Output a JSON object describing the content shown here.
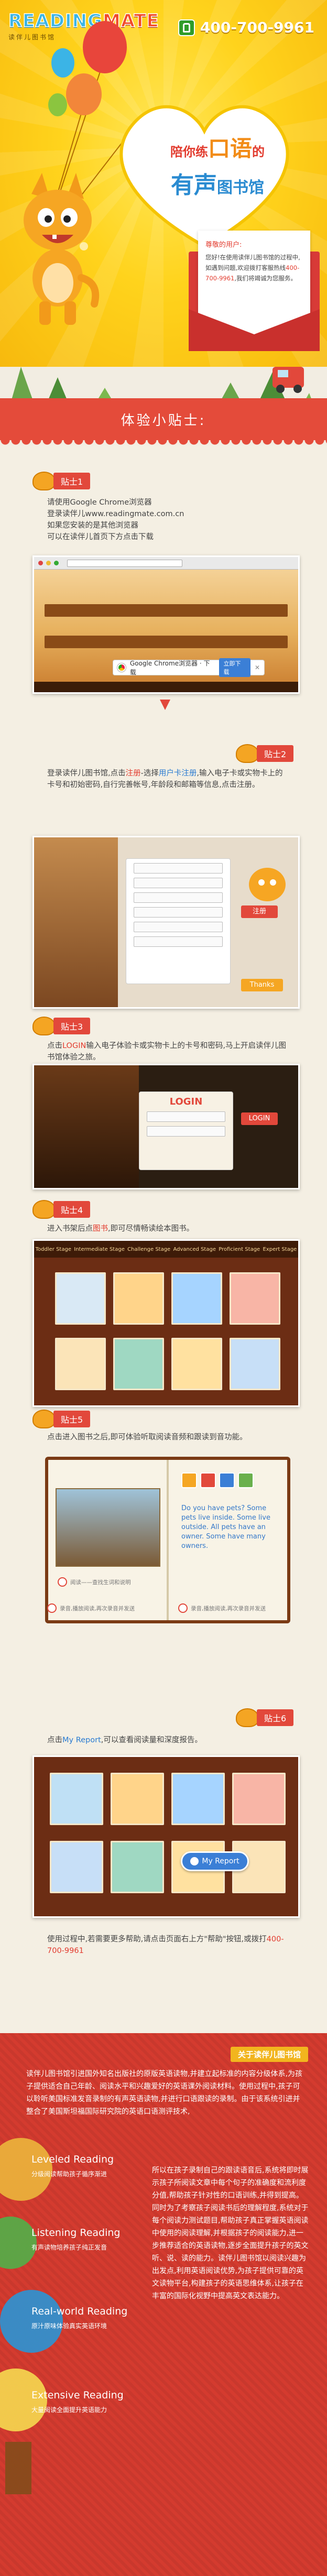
{
  "header": {
    "logo_text_1": "READING",
    "logo_text_2": "MATE",
    "logo_subtitle": "读伴儿图书馆",
    "hotline": "400-700-9961"
  },
  "hero": {
    "line1_pre": "陪你练",
    "line1_big": "口语",
    "line1_post": "的",
    "line2_big": "有声",
    "line2_post": "图书馆"
  },
  "envelope": {
    "greeting": "尊敬的用户:",
    "body_pre": "您好!在使用读伴儿图书馆的过程中,如遇到问题,欢迎拨打客服热线",
    "body_phone": "400-700-9961",
    "body_post": ",我们将竭诚为您服务。"
  },
  "banner": {
    "title": "体验小贴士:"
  },
  "steps": [
    {
      "label": "贴士1",
      "lines": [
        "请使用Google Chrome浏览器",
        "登录读伴儿www.readingmate.com.cn",
        "如果您安装的是其他浏览器",
        "可以在读伴儿首页下方点击下载"
      ],
      "chrome_bar_text": "Google Chrome浏览器 · 下载",
      "chrome_bar_btn": "立即下载"
    },
    {
      "label": "贴士2",
      "text_pre": "登录读伴儿图书馆,点击",
      "text_red": "注册",
      "text_mid": "-选择",
      "text_blue": "用户卡注册",
      "text_post": ",输入电子卡或实物卡上的卡号和初始密码,自行完善帐号,年龄段和邮箱等信息,点击注册。",
      "button_register": "注册",
      "button_thanks": "Thanks"
    },
    {
      "label": "贴士3",
      "text_pre": "点击",
      "text_red": "LOGIN",
      "text_post": "输入电子体验卡或实物卡上的卡号和密码,马上开启读伴儿图书馆体验之旅。",
      "login_title": "LOGIN",
      "login_btn": "LOGIN"
    },
    {
      "label": "贴士4",
      "text_pre": "进入书架后点",
      "text_red": "图书",
      "text_post": ",即可尽情畅读绘本图书。",
      "tabs": [
        "Toddler Stage",
        "Intermediate Stage",
        "Challenge Stage",
        "Advanced Stage",
        "Proficient Stage",
        "Expert Stage"
      ]
    },
    {
      "label": "贴士5",
      "text": "点击进入图书之后,即可体验听取阅读音频和跟读到音功能。",
      "speech": "Do you have pets? Some pets live inside. Some live outside. All pets have an owner. Some have many owners.",
      "note_1": "阅读——查找生词和说明",
      "note_2": "录音,播放阅读,再次录音并发送",
      "note_3": "录音,播放阅读,再次录音并发送"
    },
    {
      "label": "贴士6",
      "text_pre": "点击",
      "text_blue": "My Report",
      "text_post": ",可以查看阅读量和深度报告。",
      "report_btn": "My Report"
    }
  ],
  "help_text_pre": "使用过程中,若需要更多帮助,请点击页面右上方\"帮助\"按钮,或拨打",
  "help_phone": "400-700-9961",
  "footer": {
    "tag": "关于读伴儿图书馆",
    "para1": "读伴儿图书馆引进国外知名出版社的原版英语读物,并建立起标准的内容分级体系,为孩子提供适合自己年龄、阅读水平和兴趣爱好的英语课外阅读材料。使用过程中,孩子可以聆听美国标准发音录制的有声英语读物,并进行口语跟读的录制。由于该系统引进并整合了美国斯坦福国际研究院的英语口语测评技术,",
    "para2": "所以在孩子录制自己的跟读语音后,系统将即时展示孩子所阅读文章中每个句子的准确度和流利度分值,帮助孩子针对性的口语训练,并得到提高。同时为了考察孩子阅读书后的理解程度,系统对于每个阅读力测试题目,帮助孩子真正掌握英语阅读中使用的阅读理解,并根据孩子的阅读能力,进一步推荐适合的英语读物,逐步全面提升孩子的英文听、说、读的能力。读伴儿图书馆以阅读兴趣为出发点,利用英语阅读优势,为孩子提供可靠的英文读物平台,构建孩子的英语思维体系,让孩子在丰富的国际化视野中提高英文表达能力。",
    "levels": [
      {
        "name": "Leveled Reading",
        "sub": "分级阅读帮助孩子循序渐进"
      },
      {
        "name": "Listening Reading",
        "sub": "有声读物培养孩子纯正发音"
      },
      {
        "name": "Real-world Reading",
        "sub": "原汁原味体验真实英语环境"
      },
      {
        "name": "Extensive Reading",
        "sub": "大量阅读全面提升英语能力"
      }
    ]
  },
  "colors": {
    "hero_yellow": "#ffd31c",
    "accent_red": "#e2483b",
    "accent_blue": "#2a8bd1",
    "footer_red": "#d43b2f"
  }
}
